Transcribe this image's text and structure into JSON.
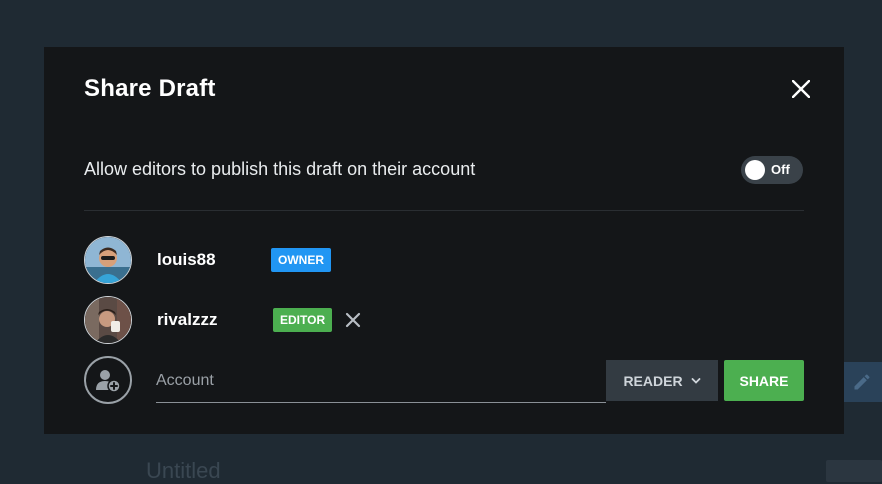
{
  "background": {
    "draft_title": "Untitled",
    "badge_text": "OWNER"
  },
  "modal": {
    "title": "Share Draft",
    "allow_publish": {
      "label": "Allow editors to publish this draft on their account",
      "toggle_state": "Off"
    },
    "users": [
      {
        "name": "louis88",
        "role": "OWNER",
        "role_color": "#2196f3"
      },
      {
        "name": "rivalzzz",
        "role": "EDITOR",
        "role_color": "#4caf50"
      }
    ],
    "add_account": {
      "placeholder": "Account",
      "value": "",
      "role": "READER",
      "share_label": "SHARE"
    }
  },
  "colors": {
    "owner_badge": "#2196f3",
    "editor_badge": "#4caf50",
    "share_button": "#4caf50"
  }
}
